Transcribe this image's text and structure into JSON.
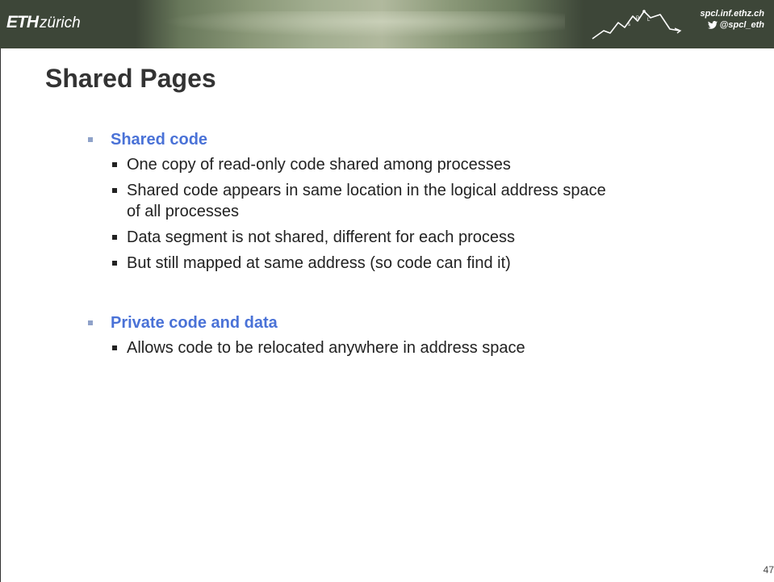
{
  "header": {
    "logo_main": "ETH",
    "logo_sub": "zürich",
    "website": "spcl.inf.ethz.ch",
    "twitter": "@spcl_eth"
  },
  "slide": {
    "title": "Shared Pages",
    "sections": [
      {
        "heading": "Shared code",
        "items": [
          "One copy of read-only code shared among processes",
          "Shared code appears in same location in the logical address space of all processes",
          "Data segment is not shared, different for each process",
          "But still mapped at same address (so code can find it)"
        ]
      },
      {
        "heading": "Private code and data",
        "items": [
          "Allows code to be relocated anywhere in address space"
        ]
      }
    ],
    "page_number": "47"
  },
  "colors": {
    "header_bg": "#3d4638",
    "heading_blue": "#4a72d7",
    "title_text": "#333333"
  }
}
